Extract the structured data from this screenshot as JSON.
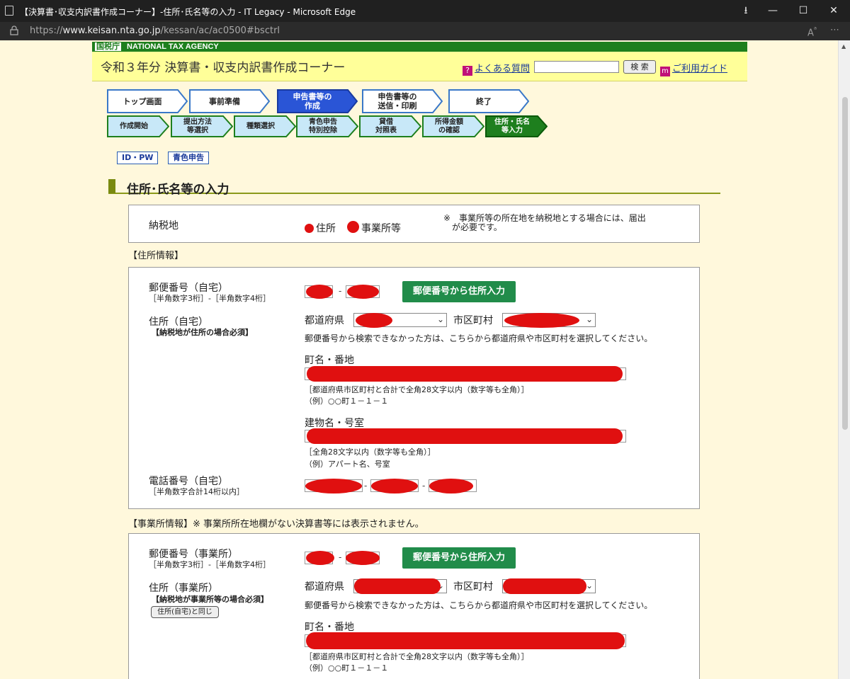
{
  "window": {
    "title": "【決算書･収支内訳書作成コーナー】-住所･氏名等の入力 - IT Legacy - Microsoft Edge"
  },
  "address": {
    "scheme": "https://",
    "host": "www.keisan.nta.go.jp",
    "path": "/kessan/ac/ac0500#bsctrl"
  },
  "header": {
    "agency_kanji": "国税庁",
    "agency": "NATIONAL TAX AGENCY",
    "corner_title": "令和３年分 決算書・収支内訳書作成コーナー",
    "faq": "よくある質問",
    "search_button": "検 索",
    "guide": "ご利用ガイド",
    "search_value": ""
  },
  "steps": [
    "トップ画面",
    "事前準備",
    "申告書等の\n作成",
    "申告書等の\n送信・印刷",
    "終了"
  ],
  "substeps": [
    "作成開始",
    "提出方法\n等選択",
    "種類選択",
    "青色申告\n特別控除",
    "貸借\n対照表",
    "所得金額\nの確認",
    "住所・氏名\n等入力"
  ],
  "tags": [
    "ID・PW",
    "青色申告"
  ],
  "section_title": "住所･氏名等の入力",
  "tax_place": {
    "label": "納税地",
    "opt1": "住所",
    "opt2": "事業所等",
    "note": "※　事業所等の所在地を納税地とする場合には、届出\n　が必要です。"
  },
  "home": {
    "heading": "【住所情報】",
    "postal_label": "郵便番号（自宅）",
    "postal_note": "［半角数字3桁］-［半角数字4桁］",
    "postal_button": "郵便番号から住所入力",
    "address_label": "住所（自宅）",
    "address_note": "【納税地が住所の場合必須】",
    "pref_label": "都道府県",
    "city_label": "市区町村",
    "search_note": "郵便番号から検索できなかった方は、こちらから都道府県や市区町村を選択してください。",
    "town_label": "町名・番地",
    "town_note1": "［都道府県市区町村と合計で全角28文字以内（数字等も全角）］",
    "town_note2": "（例）○○町１－１－１",
    "bldg_label": "建物名・号室",
    "bldg_note1": "［全角28文字以内（数字等も全角）］",
    "bldg_note2": "（例）アパート名、号室",
    "phone_label": "電話番号（自宅）",
    "phone_note": "［半角数字合計14桁以内］"
  },
  "office": {
    "heading": "【事業所情報】※ 事業所所在地欄がない決算書等には表示されません。",
    "postal_label": "郵便番号（事業所）",
    "postal_note": "［半角数字3桁］-［半角数字4桁］",
    "postal_button": "郵便番号から住所入力",
    "address_label": "住所（事業所）",
    "address_note": "【納税地が事業所等の場合必須】",
    "same_button": "住所(自宅)と同じ",
    "pref_label": "都道府県",
    "city_label": "市区町村",
    "search_note": "郵便番号から検索できなかった方は、こちらから都道府県や市区町村を選択してください。",
    "town_label": "町名・番地",
    "town_note1": "［都道府県市区町村と合計で全角28文字以内（数字等も全角）］",
    "town_note2": "（例）○○町１－１－１"
  },
  "colors": {
    "nta_green": "#1e7f1e",
    "header_yellow": "#ffff99",
    "button_green": "#218c4a",
    "redaction": "#e01010",
    "active_step": "#2a55d6"
  }
}
